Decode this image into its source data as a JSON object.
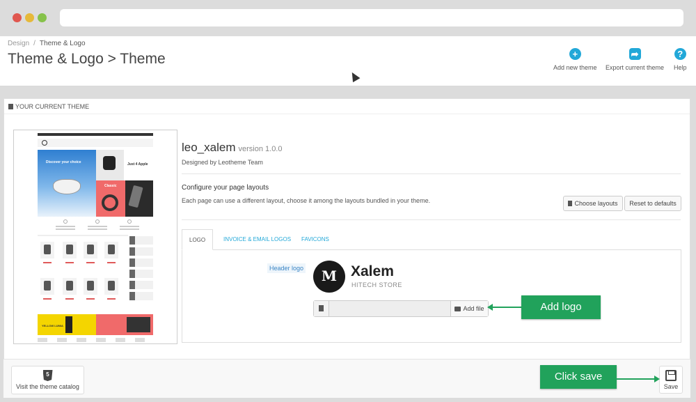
{
  "breadcrumb": {
    "parent": "Design",
    "separator": "/",
    "current": "Theme & Logo"
  },
  "page_title": "Theme & Logo > Theme",
  "toolbar": {
    "add_new_theme": "Add new theme",
    "export_current_theme": "Export current theme",
    "help": "Help",
    "icons": {
      "add": "+",
      "export": "➦",
      "help": "?"
    }
  },
  "panel": {
    "heading": "YOUR CURRENT THEME",
    "preview_texts": {
      "hero": "Discover your choice",
      "promo": "Just 4 Apple",
      "classic": "Classic",
      "yellow": "YELLOW LUMIA"
    },
    "theme": {
      "name": "leo_xalem",
      "version": "version 1.0.0",
      "designed_by": "Designed by Leotheme Team"
    },
    "layouts": {
      "title": "Configure your page layouts",
      "description": "Each page can use a different layout, choose it among the layouts bundled in your theme.",
      "choose_button": "Choose layouts",
      "reset_button": "Reset to defaults"
    },
    "tabs": [
      "LOGO",
      "INVOICE & EMAIL LOGOS",
      "FAVICONS"
    ],
    "logo_tab": {
      "field_label": "Header logo",
      "logo_mark": "M",
      "logo_name": "Xalem",
      "logo_tagline": "HITECH STORE",
      "add_file": "Add file"
    }
  },
  "callouts": {
    "add_logo": "Add logo",
    "click_save": "Click save"
  },
  "footer": {
    "catalog_button": "Visit the theme catalog",
    "catalog_icon": "5",
    "save_button": "Save"
  },
  "colors": {
    "accent": "#22a8d8",
    "callout": "#21a25b"
  }
}
